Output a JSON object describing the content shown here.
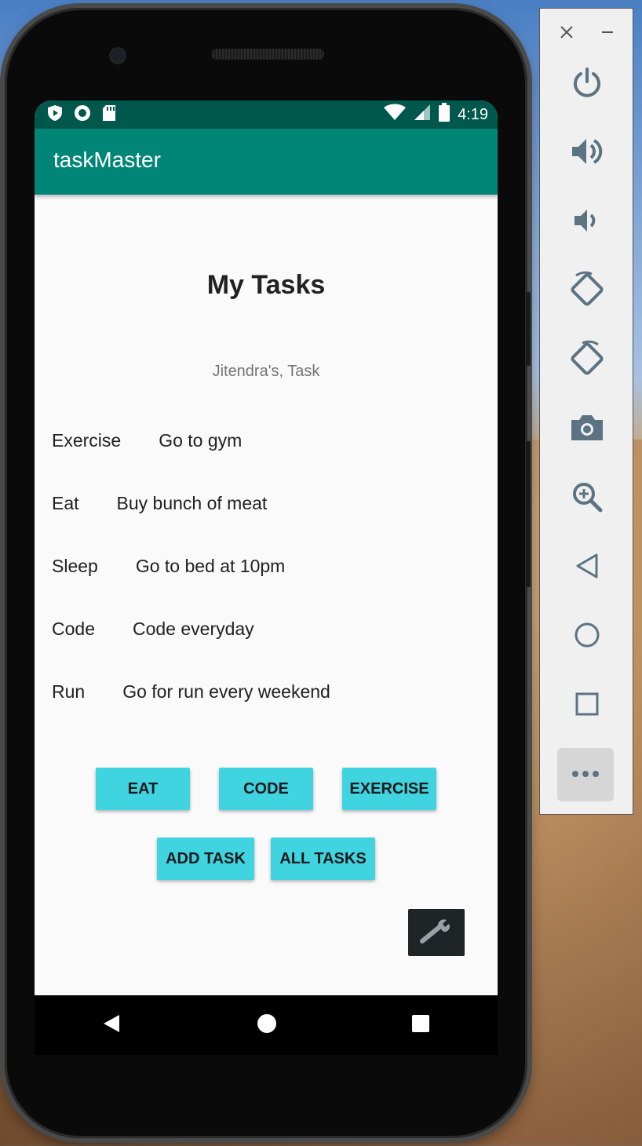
{
  "app": {
    "title": "taskMaster"
  },
  "status_bar": {
    "time": "4:19",
    "icons": [
      "play-protect-icon",
      "sync-icon",
      "sd-card-icon",
      "wifi-icon",
      "signal-icon",
      "battery-icon"
    ]
  },
  "main": {
    "heading": "My Tasks",
    "subheading": "Jitendra's, Task",
    "tasks": [
      {
        "name": "Exercise",
        "description": "Go to gym"
      },
      {
        "name": "Eat",
        "description": "Buy bunch of meat"
      },
      {
        "name": "Sleep",
        "description": "Go to bed at 10pm"
      },
      {
        "name": "Code",
        "description": "Code everyday"
      },
      {
        "name": "Run",
        "description": "Go for run every weekend"
      }
    ],
    "buttons": {
      "eat": "EAT",
      "code": "CODE",
      "exercise": "EXERCISE",
      "add_task": "ADD TASK",
      "all_tasks": "ALL TASKS"
    },
    "settings_icon": "wrench-icon"
  },
  "nav_bar": {
    "icons": [
      "back-icon",
      "home-icon",
      "recents-icon"
    ]
  },
  "emulator_panel": {
    "tools": [
      "close-icon",
      "minimize-icon",
      "power-icon",
      "volume-up-icon",
      "volume-down-icon",
      "rotate-left-icon",
      "rotate-right-icon",
      "camera-icon",
      "zoom-icon",
      "back-icon",
      "home-icon",
      "overview-icon",
      "more-icon"
    ]
  },
  "colors": {
    "status_bar": "#00574b",
    "app_bar": "#008577",
    "button": "#40d3e0",
    "panel_icon": "#5b7382"
  }
}
